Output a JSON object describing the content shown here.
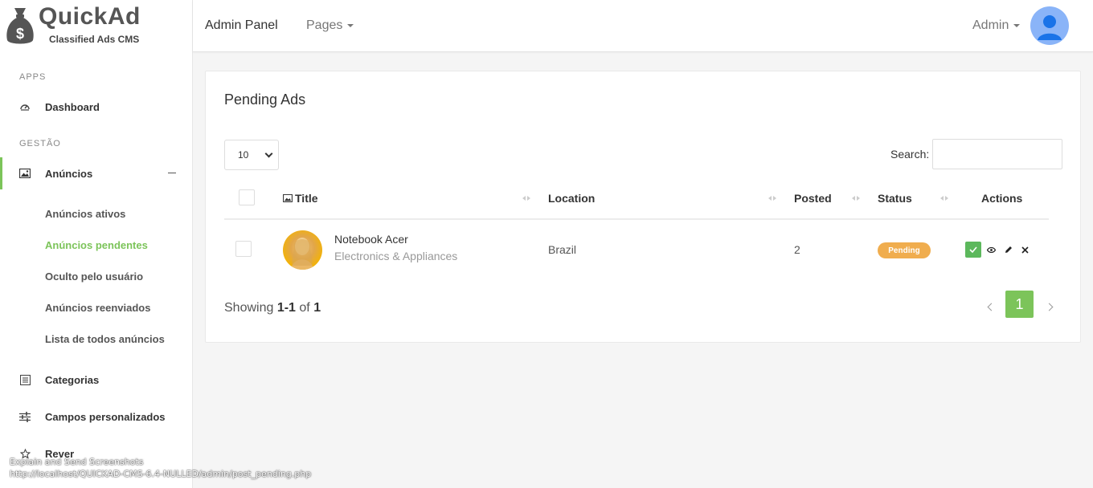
{
  "logo": {
    "title": "QuickAd",
    "subtitle": "Classified Ads CMS"
  },
  "sidebar": {
    "sections": [
      "APPS",
      "GESTÃO"
    ],
    "items": [
      {
        "label": "Dashboard",
        "icon": "dashboard-icon"
      },
      {
        "label": "Anúncios",
        "icon": "image-icon"
      },
      {
        "label": "Categorias",
        "icon": "list-icon"
      },
      {
        "label": "Campos personalizados",
        "icon": "sliders-icon"
      },
      {
        "label": "Rever",
        "icon": "star-icon"
      }
    ],
    "subitems": [
      "Anúncios ativos",
      "Anúncios pendentes",
      "Oculto pelo usuário",
      "Anúncios reenviados",
      "Lista de todos anúncios"
    ]
  },
  "header": {
    "brand": "Admin Panel",
    "pages_menu": "Pages",
    "user_menu": "Admin"
  },
  "card": {
    "title": "Pending Ads",
    "page_length": "10",
    "search_label": "Search:",
    "search_value": "",
    "columns": [
      "Title",
      "Location",
      "Posted",
      "Status",
      "Actions"
    ],
    "rows": [
      {
        "title": "Notebook Acer",
        "category": "Electronics & Appliances",
        "location": "Brazil",
        "posted": "2",
        "status": "Pending"
      }
    ],
    "showing_prefix": "Showing ",
    "showing_range": "1-1",
    "showing_of": " of ",
    "showing_total": "1",
    "current_page": "1"
  },
  "status_bar": {
    "line1": "Explain and Send Screenshots",
    "line2": "http://localhost/QUICKAD-CMS-6.4-NULLED/admin/post_pending.php"
  },
  "colors": {
    "accent": "#7cc45a",
    "pending": "#f0ad4e",
    "approve": "#5cb85c"
  }
}
